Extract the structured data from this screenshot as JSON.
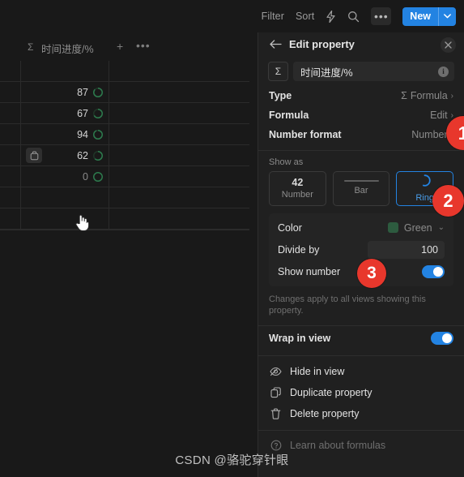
{
  "toolbar": {
    "filter_label": "Filter",
    "sort_label": "Sort",
    "lightning_icon": "lightning-icon",
    "search_icon": "search-icon",
    "more_label": "•••",
    "new_label": "New",
    "new_chevron": "chevron-down-icon"
  },
  "table": {
    "column": {
      "sigma_glyph": "Σ",
      "title": "时间进度/%",
      "add_label": "+",
      "more_label": "•••"
    },
    "rows": [
      {
        "value": "",
        "ring_pct": 0,
        "dim": true,
        "handle": false
      },
      {
        "value": "87",
        "ring_pct": 87,
        "dim": false,
        "handle": false
      },
      {
        "value": "67",
        "ring_pct": 67,
        "dim": false,
        "handle": false
      },
      {
        "value": "94",
        "ring_pct": 94,
        "dim": false,
        "handle": false
      },
      {
        "value": "62",
        "ring_pct": 62,
        "dim": false,
        "handle": true
      },
      {
        "value": "0",
        "ring_pct": 0,
        "dim": true,
        "handle": false
      },
      {
        "value": "",
        "ring_pct": 0,
        "dim": true,
        "handle": false
      },
      {
        "value": "",
        "ring_pct": 0,
        "dim": true,
        "handle": false
      }
    ],
    "ring_color": "#2d7a4d",
    "ring_track": "#2b2b2b"
  },
  "panel": {
    "back_icon": "arrow-left-icon",
    "title": "Edit property",
    "close_icon": "close-icon",
    "name_field": {
      "type_glyph": "Σ",
      "value": "时间进度/%",
      "info_icon": "info-icon"
    },
    "rows": [
      {
        "key": "Type",
        "value": "Formula",
        "glyph": "Σ",
        "chevron": "›"
      },
      {
        "key": "Formula",
        "value": "Edit",
        "glyph": "",
        "chevron": "›"
      },
      {
        "key": "Number format",
        "value": "Number",
        "glyph": "",
        "chevron": "›"
      }
    ],
    "show_as": {
      "label": "Show as",
      "options": [
        {
          "name": "Number",
          "sample": "42",
          "selected": false
        },
        {
          "name": "Bar",
          "sample": "",
          "selected": false
        },
        {
          "name": "Ring",
          "sample": "",
          "selected": true
        }
      ]
    },
    "options": {
      "color": {
        "label": "Color",
        "value": "Green",
        "swatch": "#2d5b3f",
        "chevron": "⌄"
      },
      "divide_by": {
        "label": "Divide by",
        "value": "100"
      },
      "show_number": {
        "label": "Show number",
        "enabled": true
      }
    },
    "note": "Changes apply to all views showing this property.",
    "wrap_in_view": {
      "label": "Wrap in view",
      "enabled": true
    },
    "menu": [
      {
        "label": "Hide in view",
        "icon": "eye-off-icon",
        "muted": false
      },
      {
        "label": "Duplicate property",
        "icon": "duplicate-icon",
        "muted": false
      },
      {
        "label": "Delete property",
        "icon": "trash-icon",
        "muted": false
      },
      {
        "label": "Learn about formulas",
        "icon": "question-circle-icon",
        "muted": true
      }
    ]
  },
  "badges": [
    {
      "label": "1"
    },
    {
      "label": "2"
    },
    {
      "label": "3"
    }
  ],
  "watermark": "CSDN @骆驼穿针眼",
  "colors": {
    "accent": "#2383e2",
    "badge": "#e8372c",
    "ring_green": "#2d7a4d",
    "panel_bg": "#202020",
    "app_bg": "#191919"
  }
}
